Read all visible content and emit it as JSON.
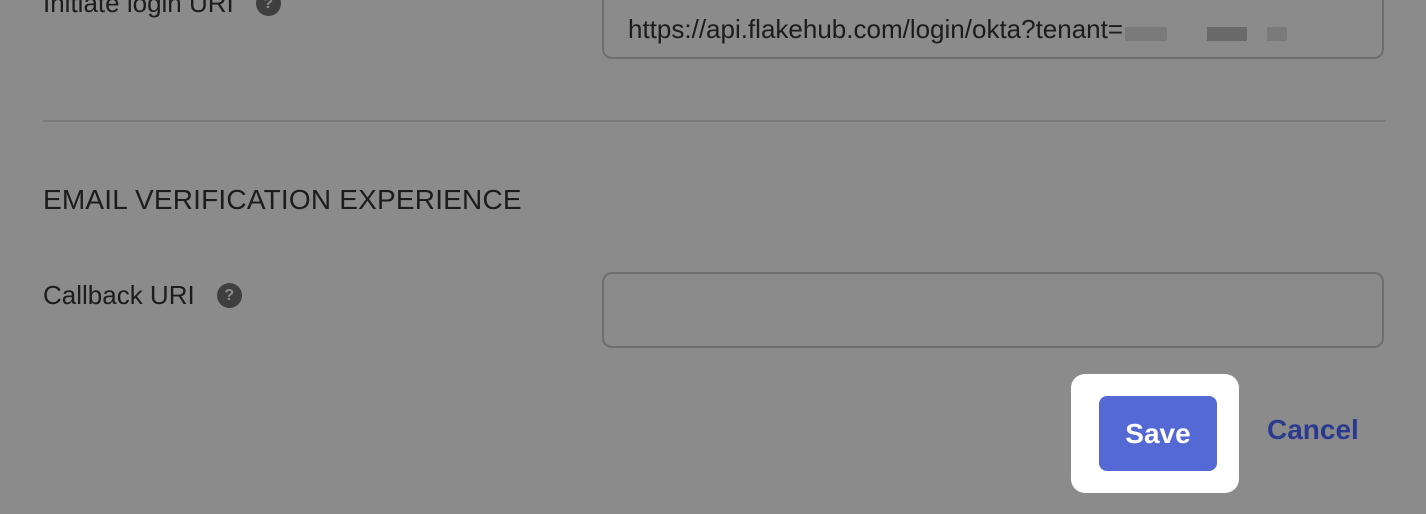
{
  "login_section": {
    "initiate_login_label": "Initiate login URI",
    "initiate_login_value": "https://api.flakehub.com/login/okta?tenant="
  },
  "email_section": {
    "title": "EMAIL VERIFICATION EXPERIENCE",
    "callback_label": "Callback URI",
    "callback_value": ""
  },
  "icons": {
    "help_glyph": "?"
  },
  "actions": {
    "save_label": "Save",
    "cancel_label": "Cancel"
  },
  "colors": {
    "overlay": "#8b8b8b",
    "save_button": "#5469d4",
    "cancel_link": "#2a3a8f",
    "highlight": "#ffffff"
  }
}
